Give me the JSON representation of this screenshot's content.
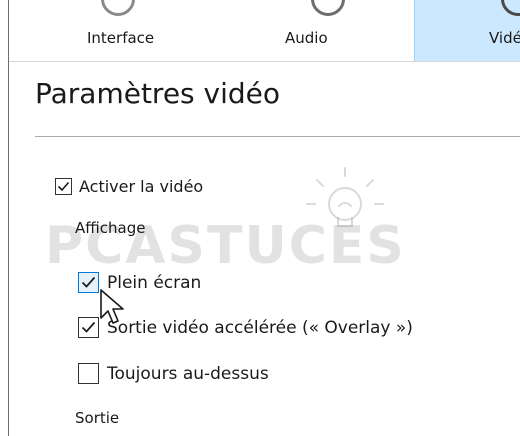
{
  "tabs": [
    {
      "label": "Interface",
      "icon": "interface-icon"
    },
    {
      "label": "Audio",
      "icon": "audio-icon"
    },
    {
      "label": "Vidé",
      "icon": "video-icon",
      "selected": true
    }
  ],
  "page": {
    "title": "Paramètres vidéo"
  },
  "options": {
    "activer": {
      "label": "Activer la vidéo",
      "checked": true
    },
    "affichage_label": "Affichage",
    "plein_ecran": {
      "label": "Plein écran",
      "checked": true
    },
    "sortie_acceleree": {
      "label": "Sortie vidéo accélérée (« Overlay »)",
      "checked": true
    },
    "toujours": {
      "label": "Toujours au-dessus",
      "checked": false
    },
    "sortie_label": "Sortie"
  },
  "watermark": {
    "text": "PCASTUCES"
  },
  "colors": {
    "tab_selected_bg": "#cce8ff",
    "tab_selected_border": "#99d1ff",
    "checkbox_focus": "#0078d7"
  }
}
